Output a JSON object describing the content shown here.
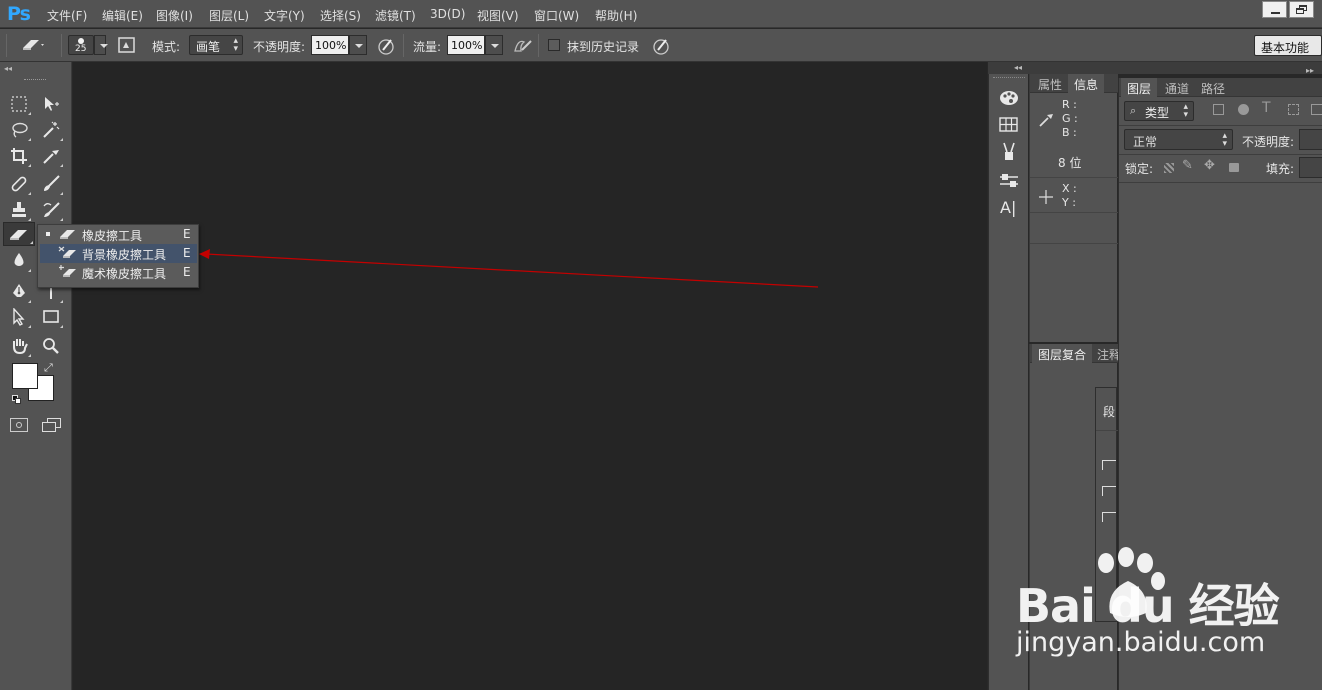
{
  "app": {
    "logo": "Ps"
  },
  "menu": [
    "文件(F)",
    "编辑(E)",
    "图像(I)",
    "图层(L)",
    "文字(Y)",
    "选择(S)",
    "滤镜(T)",
    "3D(D)",
    "视图(V)",
    "窗口(W)",
    "帮助(H)"
  ],
  "options_bar": {
    "brush_size": "25",
    "mode_label": "模式:",
    "mode_value": "画笔",
    "opacity_label": "不透明度:",
    "opacity_value": "100%",
    "flow_label": "流量:",
    "flow_value": "100%",
    "erase_history_label": "抹到历史记录",
    "workspace": "基本功能"
  },
  "flyout": {
    "items": [
      {
        "label": "橡皮擦工具",
        "shortcut": "E",
        "active": true
      },
      {
        "label": "背景橡皮擦工具",
        "shortcut": "E",
        "highlighted": true
      },
      {
        "label": "魔术橡皮擦工具",
        "shortcut": "E"
      }
    ]
  },
  "info_panel": {
    "tabs": [
      "属性",
      "信息"
    ],
    "r": "R :",
    "g": "G :",
    "b": "B :",
    "bit": "8 位",
    "x": "X :",
    "y": "Y :"
  },
  "layer_comps": {
    "tabs": [
      "图层复合",
      "注释"
    ]
  },
  "para_panel": {
    "title": "段"
  },
  "layers_panel": {
    "tabs": [
      "图层",
      "通道",
      "路径"
    ],
    "filter": "类型",
    "blend": "正常",
    "opacity_label": "不透明度:",
    "lock_label": "锁定:",
    "fill_label": "填充:"
  },
  "watermark": {
    "brand": "Bai du 经验",
    "url": "jingyan.baidu.com"
  },
  "colors": {
    "accent": "#31a8ff",
    "annotation_arrow": "#c40000",
    "highlight": "#43536b"
  }
}
